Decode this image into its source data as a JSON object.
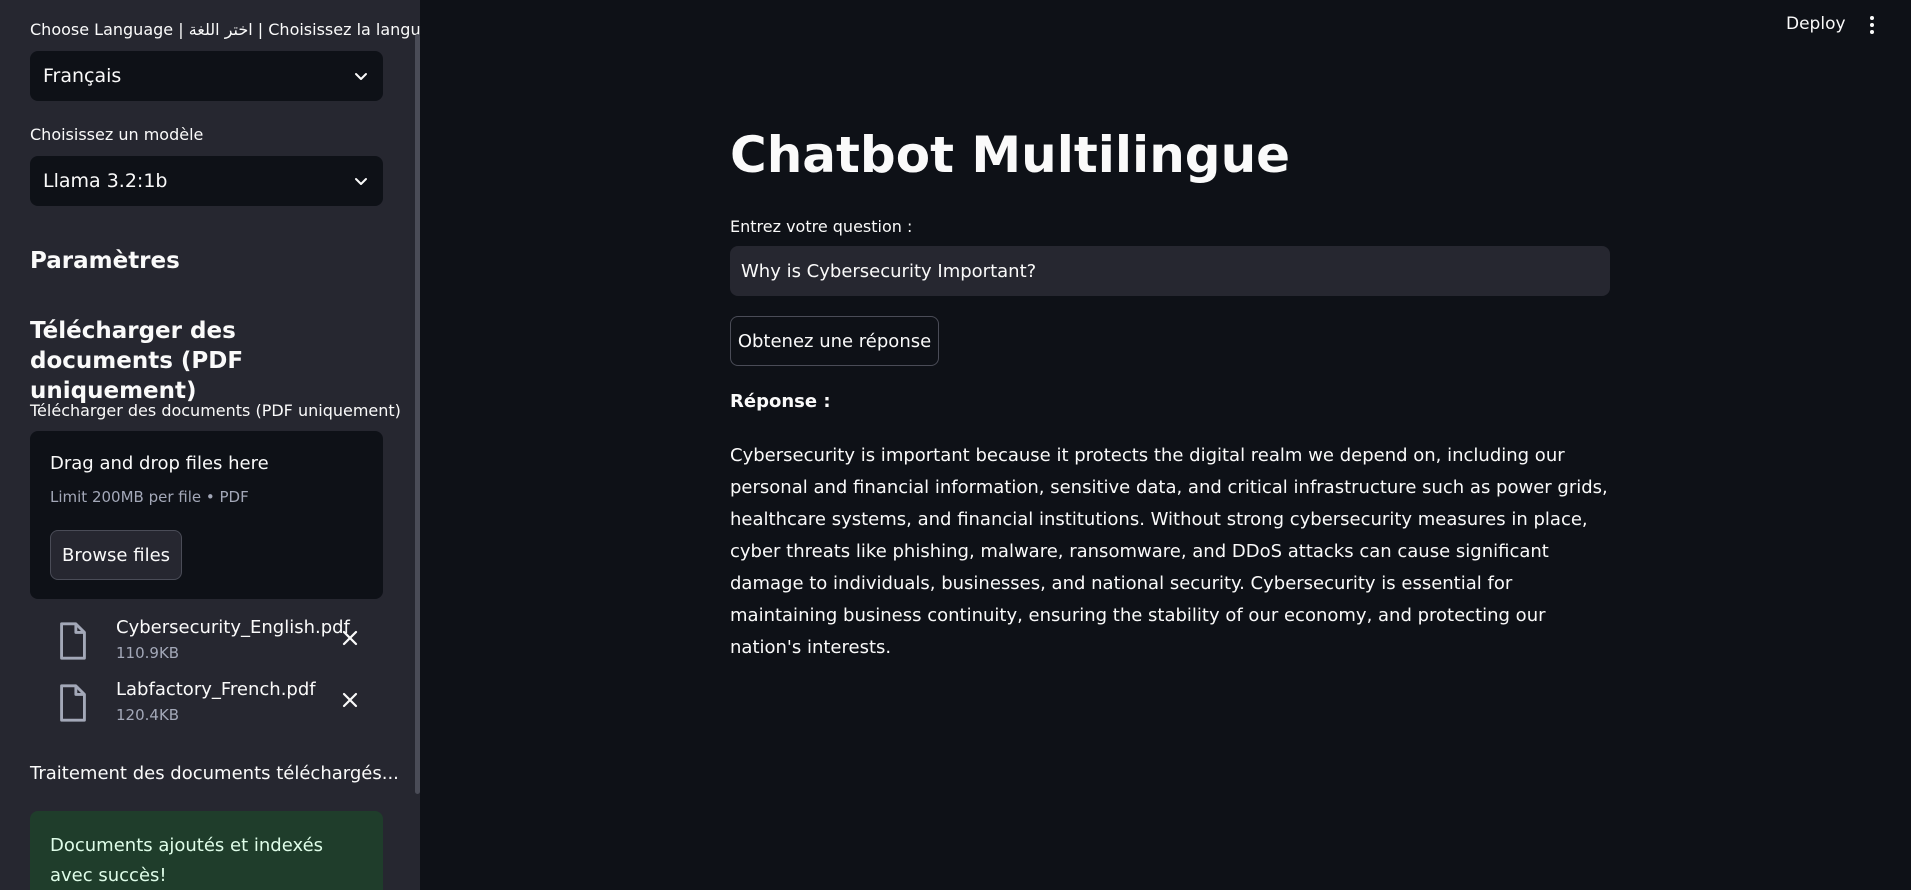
{
  "sidebar": {
    "language_label": "Choose Language | اختر اللغة | Choisissez la langue",
    "language_value": "Français",
    "model_label": "Choisissez un modèle",
    "model_value": "Llama 3.2:1b",
    "params_heading": "Paramètres",
    "upload_heading": "Télécharger des documents (PDF uniquement)",
    "upload_label": "Télécharger des documents (PDF uniquement)",
    "dropzone": {
      "title": "Drag and drop files here",
      "limit": "Limit 200MB per file • PDF",
      "browse_label": "Browse files"
    },
    "files": [
      {
        "name": "Cybersecurity_English.pdf",
        "size": "110.9KB"
      },
      {
        "name": "Labfactory_French.pdf",
        "size": "120.4KB"
      }
    ],
    "processing_text": "Traitement des documents téléchargés...",
    "success_text": "Documents ajoutés et indexés avec succès!"
  },
  "header": {
    "deploy_label": "Deploy"
  },
  "main": {
    "title": "Chatbot Multilingue",
    "question_label": "Entrez votre question :",
    "question_value": "Why is Cybersecurity Important?",
    "submit_label": "Obtenez une réponse",
    "response_label": "Réponse :",
    "response_text": "Cybersecurity is important because it protects the digital realm we depend on, including our personal and financial information, sensitive data, and critical infrastructure such as power grids, healthcare systems, and financial institutions. Without strong cybersecurity measures in place, cyber threats like phishing, malware, ransomware, and DDoS attacks can cause significant damage to individuals, businesses, and national security. Cybersecurity is essential for maintaining business continuity, ensuring the stability of our economy, and protecting our nation's interests."
  },
  "icons": {
    "select_chevron": "chevron-down-icon",
    "file": "file-icon",
    "remove": "close-icon",
    "menu": "kebab-menu-icon"
  },
  "colors": {
    "background": "#0e1117",
    "sidebar": "#262730",
    "success_bg": "#1f3d2b",
    "success_text": "#dffde9"
  }
}
